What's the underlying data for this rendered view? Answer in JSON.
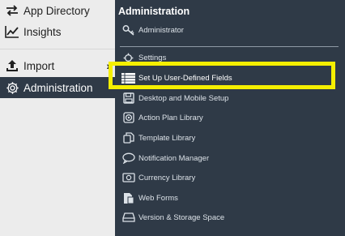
{
  "sidebar": {
    "items": [
      {
        "label": "App Directory",
        "icon": "swap-arrows-icon"
      },
      {
        "label": "Insights",
        "icon": "trend-chart-icon"
      },
      {
        "label": "Import",
        "icon": "upload-icon"
      },
      {
        "label": "Administration",
        "icon": "gear-icon"
      }
    ]
  },
  "panel": {
    "title": "Administration",
    "items": [
      {
        "label": "Administrator",
        "icon": "key-icon"
      },
      {
        "label": "Settings",
        "icon": "gear-icon"
      },
      {
        "label": "Set Up User-Defined Fields",
        "icon": "list-icon"
      },
      {
        "label": "Desktop and Mobile Setup",
        "icon": "floppy-disk-icon"
      },
      {
        "label": "Action Plan Library",
        "icon": "target-icon"
      },
      {
        "label": "Template Library",
        "icon": "copy-icon"
      },
      {
        "label": "Notification Manager",
        "icon": "speech-bubble-icon"
      },
      {
        "label": "Currency Library",
        "icon": "currency-icon"
      },
      {
        "label": "Web Forms",
        "icon": "forms-icon"
      },
      {
        "label": "Version & Storage Space",
        "icon": "drive-icon"
      }
    ]
  },
  "colors": {
    "panel_bg": "#2f3a47",
    "sidebar_bg": "#ececec",
    "highlight": "#f5ef00"
  }
}
